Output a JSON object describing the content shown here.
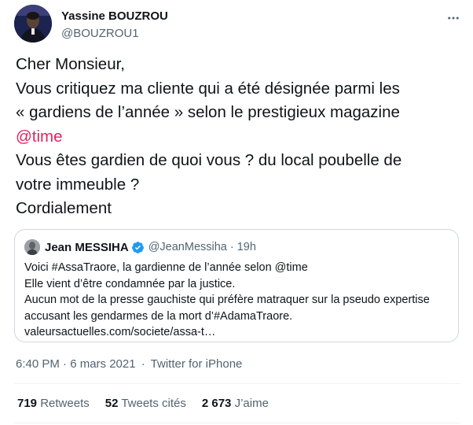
{
  "author": {
    "name": "Yassine BOUZROU",
    "handle": "@BOUZROU1",
    "avatar_icon": "profile-photo"
  },
  "tweet": {
    "lines": [
      "Cher Monsieur,",
      "Vous critiquez ma cliente qui a été désignée parmi les",
      "« gardiens de l’année » selon le prestigieux magazine",
      "@time",
      "Vous êtes gardien de quoi vous ? du local poubelle de",
      "votre immeuble ?",
      "Cordialement"
    ],
    "mention_color": "#e0245e"
  },
  "quoted_tweet": {
    "name": "Jean MESSIHA",
    "verified": true,
    "handle": "@JeanMessiha",
    "separator": "·",
    "time": "19h",
    "lines": [
      "Voici #AssaTraore, la gardienne de l’année selon @time",
      "Elle vient d’être condamnée par la justice.",
      "Aucun mot de la presse gauchiste qui préfère matraquer sur la pseudo expertise",
      "accusant les gendarmes de la mort d’#AdamaTraore.",
      "valeursactuelles.com/societe/assa-t…"
    ]
  },
  "meta": {
    "timestamp": "6:40 PM · 6 mars 2021",
    "separator": "·",
    "source": "Twitter for iPhone"
  },
  "stats": {
    "retweets_count": "719",
    "retweets_label": "Retweets",
    "quotes_count": "52",
    "quotes_label": "Tweets cités",
    "likes_count": "2 673",
    "likes_label": "J’aime"
  },
  "colors": {
    "text": "#0f1419",
    "secondary": "#536471",
    "border": "#cfd9de",
    "verified": "#1d9bf0"
  }
}
